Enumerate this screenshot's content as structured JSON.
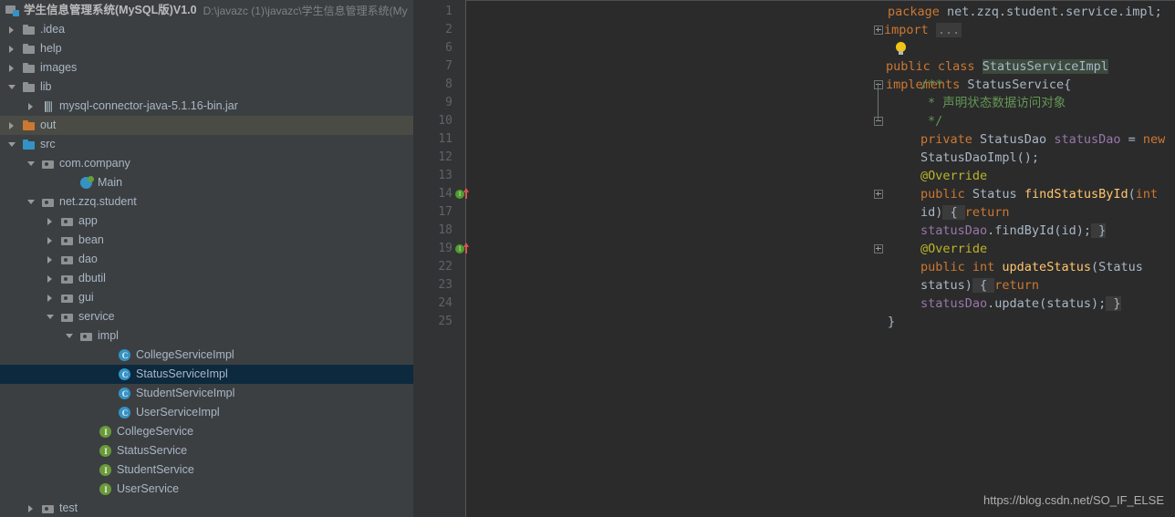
{
  "colors": {
    "sidebar_bg": "#3c3f41",
    "editor_bg": "#2b2b2b",
    "gutter_bg": "#313335",
    "selection": "#0d293e",
    "hover": "#4b4b45",
    "text": "#a9b7c6",
    "keyword": "#cc7832",
    "comment": "#629755",
    "annotation": "#bbb529",
    "method": "#ffc66d",
    "field": "#9876aa",
    "number": "#6897bb",
    "class_icon": "#3592c4",
    "interface_icon": "#6a9a3a"
  },
  "project": {
    "name": "学生信息管理系统(MySQL版)V1.0",
    "path": "D:\\javazc (1)\\javazc\\学生信息管理系统(My",
    "icon": "project-folder-icon"
  },
  "tree": [
    {
      "label": ".idea",
      "icon": "folder-icon",
      "arrow": "right",
      "indent": 0,
      "state": "normal"
    },
    {
      "label": "help",
      "icon": "folder-icon",
      "arrow": "right",
      "indent": 0,
      "state": "normal"
    },
    {
      "label": "images",
      "icon": "folder-icon",
      "arrow": "right",
      "indent": 0,
      "state": "normal"
    },
    {
      "label": "lib",
      "icon": "folder-icon",
      "arrow": "down",
      "indent": 0,
      "state": "normal"
    },
    {
      "label": "mysql-connector-java-5.1.16-bin.jar",
      "icon": "jar-icon",
      "arrow": "right",
      "indent": 1,
      "state": "normal"
    },
    {
      "label": "out",
      "icon": "folder-orange-icon",
      "arrow": "right",
      "indent": 0,
      "state": "hover"
    },
    {
      "label": "src",
      "icon": "folder-blue-icon",
      "arrow": "down",
      "indent": 0,
      "state": "normal"
    },
    {
      "label": "com.company",
      "icon": "package-icon",
      "arrow": "down",
      "indent": 1,
      "state": "normal"
    },
    {
      "label": "Main",
      "icon": "runnable-class-icon",
      "arrow": "none",
      "indent": 3,
      "state": "normal"
    },
    {
      "label": "net.zzq.student",
      "icon": "package-icon",
      "arrow": "down",
      "indent": 1,
      "state": "normal"
    },
    {
      "label": "app",
      "icon": "package-icon",
      "arrow": "right",
      "indent": 2,
      "state": "normal"
    },
    {
      "label": "bean",
      "icon": "package-icon",
      "arrow": "right",
      "indent": 2,
      "state": "normal"
    },
    {
      "label": "dao",
      "icon": "package-icon",
      "arrow": "right",
      "indent": 2,
      "state": "normal"
    },
    {
      "label": "dbutil",
      "icon": "package-icon",
      "arrow": "right",
      "indent": 2,
      "state": "normal"
    },
    {
      "label": "gui",
      "icon": "package-icon",
      "arrow": "right",
      "indent": 2,
      "state": "normal"
    },
    {
      "label": "service",
      "icon": "package-icon",
      "arrow": "down",
      "indent": 2,
      "state": "normal"
    },
    {
      "label": "impl",
      "icon": "package-icon",
      "arrow": "down",
      "indent": 3,
      "state": "normal"
    },
    {
      "label": "CollegeServiceImpl",
      "icon": "class-icon",
      "arrow": "none",
      "indent": 5,
      "state": "normal"
    },
    {
      "label": "StatusServiceImpl",
      "icon": "class-icon",
      "arrow": "none",
      "indent": 5,
      "state": "selected"
    },
    {
      "label": "StudentServiceImpl",
      "icon": "class-icon",
      "arrow": "none",
      "indent": 5,
      "state": "normal"
    },
    {
      "label": "UserServiceImpl",
      "icon": "class-icon",
      "arrow": "none",
      "indent": 5,
      "state": "normal"
    },
    {
      "label": "CollegeService",
      "icon": "interface-icon",
      "arrow": "none",
      "indent": 4,
      "state": "normal"
    },
    {
      "label": "StatusService",
      "icon": "interface-icon",
      "arrow": "none",
      "indent": 4,
      "state": "normal"
    },
    {
      "label": "StudentService",
      "icon": "interface-icon",
      "arrow": "none",
      "indent": 4,
      "state": "normal"
    },
    {
      "label": "UserService",
      "icon": "interface-icon",
      "arrow": "none",
      "indent": 4,
      "state": "normal"
    },
    {
      "label": "test",
      "icon": "package-icon",
      "arrow": "right",
      "indent": 1,
      "state": "normal"
    }
  ],
  "editor": {
    "lines": [
      {
        "num": "1",
        "gutter": "none",
        "fold": "none"
      },
      {
        "num": "2",
        "gutter": "none",
        "fold": "plus"
      },
      {
        "num": "6",
        "gutter": "none",
        "fold": "none"
      },
      {
        "num": "7",
        "gutter": "none",
        "fold": "none"
      },
      {
        "num": "8",
        "gutter": "none",
        "fold": "minus-top"
      },
      {
        "num": "9",
        "gutter": "none",
        "fold": "line"
      },
      {
        "num": "10",
        "gutter": "none",
        "fold": "minus-bottom"
      },
      {
        "num": "11",
        "gutter": "none",
        "fold": "none"
      },
      {
        "num": "12",
        "gutter": "none",
        "fold": "none"
      },
      {
        "num": "13",
        "gutter": "none",
        "fold": "none"
      },
      {
        "num": "14",
        "gutter": "implements",
        "fold": "plus"
      },
      {
        "num": "17",
        "gutter": "none",
        "fold": "none"
      },
      {
        "num": "18",
        "gutter": "none",
        "fold": "none"
      },
      {
        "num": "19",
        "gutter": "implements",
        "fold": "plus"
      },
      {
        "num": "22",
        "gutter": "none",
        "fold": "none"
      },
      {
        "num": "23",
        "gutter": "none",
        "fold": "none"
      },
      {
        "num": "24",
        "gutter": "none",
        "fold": "none"
      },
      {
        "num": "25",
        "gutter": "none",
        "fold": "none"
      }
    ],
    "code_text": {
      "l1_package": "package",
      "l1_name": " net.zzq.student.service.impl;",
      "l2_import": "import",
      "l2_dots": "...",
      "l7_public": "public",
      "l7_class": "class",
      "l7_name": "StatusServiceImpl",
      "l7_implements": "implements",
      "l7_iface": "StatusService{",
      "l8_comment": "/**",
      "l9_comment": "* 声明状态数据访问对象",
      "l10_comment": "*/",
      "l11_private": "private",
      "l11_type": " StatusDao ",
      "l11_field": "statusDao",
      "l11_eq": " = ",
      "l11_new": "new",
      "l11_ctor": " StatusDaoImpl();",
      "l13_override": "@Override",
      "l14_public": "public",
      "l14_type": " Status ",
      "l14_method": "findStatusById",
      "l14_paren": "(",
      "l14_int": "int",
      "l14_param": " id)",
      "l14_brace_open": " { ",
      "l14_return": "return",
      "l14_body": " statusDao",
      "l14_dot": ".",
      "l14_call": "findById",
      "l14_args": "(id);",
      "l14_brace_close": " } ",
      "l18_override": "@Override",
      "l19_public": "public",
      "l19_int": " int ",
      "l19_method": "updateStatus",
      "l19_paren": "(",
      "l19_param": "Status status)",
      "l19_brace_open": " { ",
      "l19_return": "return",
      "l19_body": " statusDao",
      "l19_dot": ".",
      "l19_call": "update",
      "l19_args": "(status);",
      "l19_brace_close": " } ",
      "l24_close": "}"
    }
  },
  "watermark": "https://blog.csdn.net/SO_IF_ELSE"
}
